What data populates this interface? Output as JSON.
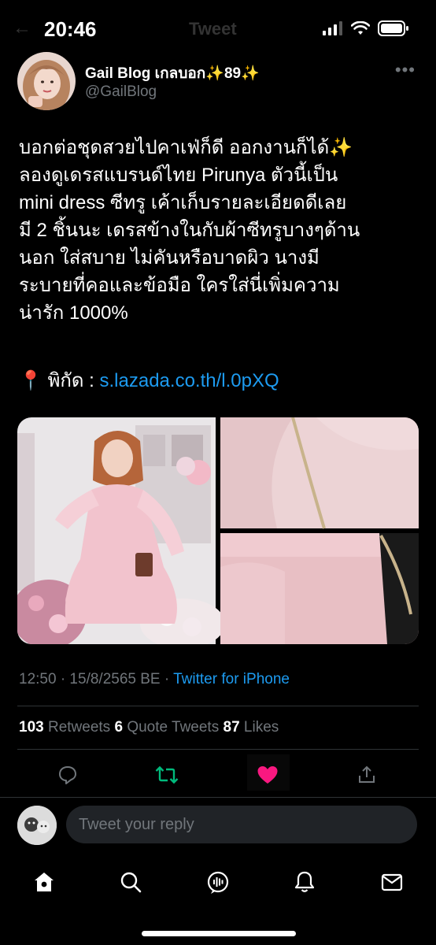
{
  "status_bar": {
    "time": "20:46",
    "ghost_title": "Tweet"
  },
  "tweet": {
    "author_name": "Gail Blog เกลบอก✨89✨",
    "author_handle": "@GailBlog",
    "text_lines": [
      "บอกต่อชุดสวยไปคาเฟ่ก็ดี ออกงานก็ได้✨",
      "ลองดูเดรสแบรนด์ไทย Pirunya ตัวนี้เป็น",
      "mini dress ซีทรู เค้าเก็บรายละเอียดดีเลย",
      "มี 2 ชิ้นนะ เดรสข้างในกับผ้าซีทรูบางๆด้าน",
      "นอก  ใส่สบาย ไม่คันหรือบาดผิว นางมี",
      "ระบายที่คอและข้อมือ  ใครใส่นี่เพิ่มความ",
      "น่ารัก 1000%"
    ],
    "location_pin": "📍",
    "location_label": "พิกัด : ",
    "location_link": "s.lazada.co.th/l.0pXQ",
    "timestamp": "12:50 · 15/8/2565 BE · ",
    "source": "Twitter for iPhone",
    "retweets_count": "103",
    "retweets_label": " Retweets  ",
    "quotes_count": "6",
    "quotes_label": " Quote Tweets  ",
    "likes_count": "87",
    "likes_label": " Likes"
  },
  "actions": [
    "reply-icon",
    "retweet-icon",
    "like-icon",
    "share-icon"
  ],
  "reply": {
    "placeholder": "Tweet your reply"
  },
  "tabbar": [
    "home-icon",
    "search-icon",
    "spaces-icon",
    "notifications-icon",
    "messages-icon"
  ],
  "colors": {
    "background": "#000000",
    "link": "#1d9bf0",
    "retweet": "#00ba7c",
    "like": "#f91880",
    "muted": "#71767b"
  }
}
